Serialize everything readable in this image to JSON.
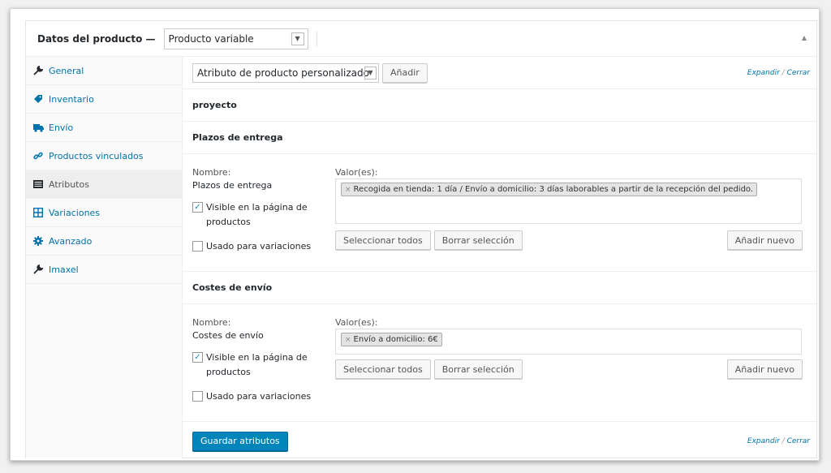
{
  "header": {
    "title": "Datos del producto —",
    "product_type": "Producto variable"
  },
  "sidebar": {
    "tabs": [
      {
        "label": "General",
        "icon": "wrench-icon"
      },
      {
        "label": "Inventario",
        "icon": "tag-icon"
      },
      {
        "label": "Envío",
        "icon": "truck-icon"
      },
      {
        "label": "Productos vinculados",
        "icon": "link-icon"
      },
      {
        "label": "Atributos",
        "icon": "list-icon"
      },
      {
        "label": "Variaciones",
        "icon": "grid-icon"
      },
      {
        "label": "Avanzado",
        "icon": "gear-icon"
      },
      {
        "label": "Imaxel",
        "icon": "wrench-icon"
      }
    ],
    "active_index": 4
  },
  "toolbar": {
    "attribute_select": "Atributo de producto personalizado",
    "add_label": "Añadir",
    "expand": "Expandir",
    "slash": "/",
    "close": "Cerrar"
  },
  "attributes": [
    {
      "title": "proyecto"
    },
    {
      "title": "Plazos de entrega",
      "name_label": "Nombre:",
      "name_value": "Plazos de entrega",
      "visible_label": "Visible en la página de productos",
      "visible_checked": true,
      "variations_label": "Usado para variaciones",
      "variations_checked": false,
      "values_label": "Valor(es):",
      "values": [
        "Recogida en tienda: 1 día / Envío a domicilio: 3 días laborables a partir de la recepción del pedido."
      ],
      "select_all": "Seleccionar todos",
      "clear": "Borrar selección",
      "add_new": "Añadir nuevo"
    },
    {
      "title": "Costes de envío",
      "name_label": "Nombre:",
      "name_value": "Costes de envío",
      "visible_label": "Visible en la página de productos",
      "visible_checked": true,
      "variations_label": "Usado para variaciones",
      "variations_checked": false,
      "values_label": "Valor(es):",
      "values": [
        "Envío a domicilio: 6€"
      ],
      "select_all": "Seleccionar todos",
      "clear": "Borrar selección",
      "add_new": "Añadir nuevo"
    }
  ],
  "footer": {
    "save_label": "Guardar atributos",
    "expand": "Expandir",
    "slash": "/",
    "close": "Cerrar"
  },
  "colors": {
    "link": "#0073aa",
    "primary": "#0085ba"
  },
  "chip_remove": "×"
}
